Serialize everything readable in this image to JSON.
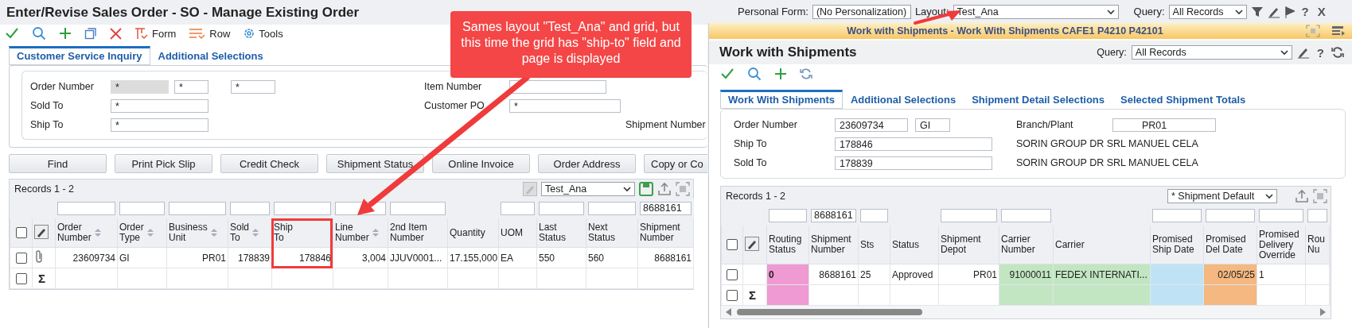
{
  "order_window": {
    "title": "Enter/Revise Sales Order - SO - Manage Existing Order",
    "menus": [
      "Form",
      "Row",
      "Tools"
    ],
    "tabs": [
      {
        "label": "Customer Service Inquiry",
        "selected": true
      },
      {
        "label": "Additional Selections",
        "selected": false
      }
    ],
    "form": {
      "order_number": {
        "label": "Order Number",
        "fields": [
          {
            "value": "*",
            "disabled": true
          },
          {
            "value": "*",
            "disabled": false
          },
          {
            "value": "*",
            "disabled": false
          }
        ]
      },
      "sold_to": {
        "label": "Sold To",
        "value": "*"
      },
      "ship_to": {
        "label": "Ship To",
        "value": "*"
      },
      "item_number": {
        "label": "Item Number"
      },
      "customer_po": {
        "label": "Customer PO",
        "value": "*"
      },
      "shipment_number": {
        "label": "Shipment Number"
      }
    },
    "buttons": [
      "Find",
      "Print Pick Slip",
      "Credit Check",
      "Shipment Status",
      "Online Invoice",
      "Order Address",
      "Copy or Co"
    ],
    "grid": {
      "records": "Records 1 - 2",
      "layout": "Test_Ana",
      "all_selected": false,
      "columns": [
        {
          "label": "Order\nNumber",
          "sortable": true,
          "filter": true,
          "highlighted": false
        },
        {
          "label": "Order\nType",
          "sortable": true,
          "filter": true,
          "highlighted": false
        },
        {
          "label": "Business\nUnit",
          "sortable": true,
          "filter": true,
          "highlighted": false
        },
        {
          "label": "Sold\nTo",
          "sortable": true,
          "filter": true,
          "highlighted": false
        },
        {
          "label": "Ship\nTo",
          "sortable": false,
          "filter": true,
          "highlighted": true
        },
        {
          "label": "Line\nNumber",
          "sortable": true,
          "filter": true,
          "highlighted": false
        },
        {
          "label": "2nd Item\nNumber",
          "sortable": false,
          "filter": true,
          "highlighted": false
        },
        {
          "label": "Quantity",
          "sortable": false,
          "filter": false,
          "highlighted": false
        },
        {
          "label": "UOM",
          "sortable": false,
          "filter": true,
          "highlighted": false
        },
        {
          "label": "Last\nStatus",
          "sortable": false,
          "filter": true,
          "highlighted": false
        },
        {
          "label": "Next\nStatus",
          "sortable": false,
          "filter": true,
          "highlighted": false
        },
        {
          "label": "Shipment\nNumber",
          "sortable": false,
          "filter": true,
          "filter_value": "8688161",
          "highlighted": false
        }
      ],
      "rows": [
        {
          "selected": false,
          "attachment": true,
          "cells": [
            "23609734",
            "GI",
            "PR01",
            "178839",
            "178846",
            "3,004",
            "JJUV0001...",
            "17.155,000",
            "EA",
            "550",
            "560",
            "8688161"
          ]
        }
      ],
      "summary_row": {
        "symbol": "Σ",
        "selected": false
      }
    }
  },
  "top_bar": {
    "personal_form": {
      "label": "Personal Form:",
      "value": "(No Personalization)"
    },
    "layout": {
      "label": "Layout:",
      "value": "Test_Ana"
    },
    "query": {
      "label": "Query:",
      "value": "All Records"
    },
    "help": "?",
    "close": "X"
  },
  "shipments_window": {
    "title_bar": "Work with Shipments - Work With Shipments CAFE1 P4210 P42101",
    "heading": "Work with Shipments",
    "query": {
      "label": "Query:",
      "value": "All Records"
    },
    "help": "?",
    "tabs": [
      {
        "label": "Work With Shipments",
        "selected": true
      },
      {
        "label": "Additional Selections",
        "selected": false
      },
      {
        "label": "Shipment Detail Selections",
        "selected": false
      },
      {
        "label": "Selected Shipment Totals",
        "selected": false
      }
    ],
    "form": {
      "order_number": {
        "label": "Order Number",
        "values": [
          "23609734",
          "GI"
        ]
      },
      "branch_plant": {
        "label": "Branch/Plant",
        "value": "PR01"
      },
      "ship_to": {
        "label": "Ship To",
        "value": "178846",
        "name": "SORIN GROUP DR SRL MANUEL CELA"
      },
      "sold_to": {
        "label": "Sold To",
        "value": "178839",
        "name": "SORIN GROUP DR SRL MANUEL CELA"
      }
    },
    "grid": {
      "records": "Records 1 - 2",
      "layout": "* Shipment Default",
      "all_selected": false,
      "columns": [
        {
          "label": "Routing\nStatus",
          "filter": true,
          "color": "#ef9ad2"
        },
        {
          "label": "Shipment\nNumber",
          "filter": true,
          "filter_value": "8688161"
        },
        {
          "label": "Sts",
          "filter": true
        },
        {
          "label": "Status",
          "filter": false
        },
        {
          "label": "Shipment\nDepot",
          "filter": true
        },
        {
          "label": "Carrier\nNumber",
          "filter": true,
          "color": "#c2e6c2"
        },
        {
          "label": "Carrier",
          "filter": false,
          "color": "#c2e6c2"
        },
        {
          "label": "Promised\nShip Date",
          "filter": true,
          "color": "#bfe3f5"
        },
        {
          "label": "Promised\nDel Date",
          "filter": true,
          "color": "#f4b880"
        },
        {
          "label": "Promised\nDelivery\nOverride",
          "filter": true
        },
        {
          "label": "Rou\nNu",
          "filter": true
        }
      ],
      "rows": [
        {
          "selected": false,
          "cells": [
            "0",
            "8688161",
            "25",
            "Approved",
            "PR01",
            "91000011",
            "FEDEX INTERNATI...",
            null,
            "02/05/25",
            "1",
            null
          ]
        }
      ],
      "summary_row": {
        "symbol": "Σ",
        "selected": false
      }
    }
  },
  "callout": {
    "text": "Sames layout \"Test_Ana\" and grid, but this time the grid has \"ship-to\" field and page is displayed"
  }
}
